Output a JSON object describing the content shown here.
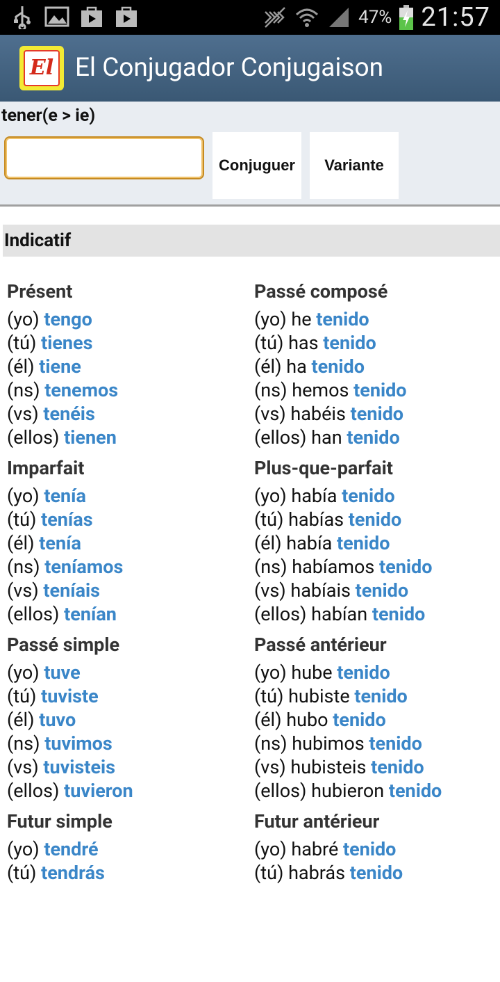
{
  "status": {
    "battery": "47%",
    "time": "21:57"
  },
  "app": {
    "title": "El Conjugador Conjugaison",
    "logo_text": "El"
  },
  "form": {
    "verb": "tener(e > ie)",
    "input_value": "",
    "conjugate_label": "Conjuguer",
    "variant_label": "Variante"
  },
  "section": "Indicatif",
  "tenses_left": [
    {
      "name": "Présent",
      "rows": [
        {
          "p": "(yo)",
          "a": "",
          "v": "tengo"
        },
        {
          "p": "(tú)",
          "a": "",
          "v": "tienes"
        },
        {
          "p": "(él)",
          "a": "",
          "v": "tiene"
        },
        {
          "p": "(ns)",
          "a": "",
          "v": "tenemos"
        },
        {
          "p": "(vs)",
          "a": "",
          "v": "tenéis"
        },
        {
          "p": "(ellos)",
          "a": "",
          "v": "tienen"
        }
      ]
    },
    {
      "name": "Imparfait",
      "rows": [
        {
          "p": "(yo)",
          "a": "",
          "v": "tenía"
        },
        {
          "p": "(tú)",
          "a": "",
          "v": "tenías"
        },
        {
          "p": "(él)",
          "a": "",
          "v": "tenía"
        },
        {
          "p": "(ns)",
          "a": "",
          "v": "teníamos"
        },
        {
          "p": "(vs)",
          "a": "",
          "v": "teníais"
        },
        {
          "p": "(ellos)",
          "a": "",
          "v": "tenían"
        }
      ]
    },
    {
      "name": "Passé simple",
      "rows": [
        {
          "p": "(yo)",
          "a": "",
          "v": "tuve"
        },
        {
          "p": "(tú)",
          "a": "",
          "v": "tuviste"
        },
        {
          "p": "(él)",
          "a": "",
          "v": "tuvo"
        },
        {
          "p": "(ns)",
          "a": "",
          "v": "tuvimos"
        },
        {
          "p": "(vs)",
          "a": "",
          "v": "tuvisteis"
        },
        {
          "p": "(ellos)",
          "a": "",
          "v": "tuvieron"
        }
      ]
    },
    {
      "name": "Futur simple",
      "rows": [
        {
          "p": "(yo)",
          "a": "",
          "v": "tendré"
        },
        {
          "p": "(tú)",
          "a": "",
          "v": "tendrás"
        }
      ]
    }
  ],
  "tenses_right": [
    {
      "name": "Passé composé",
      "rows": [
        {
          "p": "(yo)",
          "a": "he",
          "v": "tenido"
        },
        {
          "p": "(tú)",
          "a": "has",
          "v": "tenido"
        },
        {
          "p": "(él)",
          "a": "ha",
          "v": "tenido"
        },
        {
          "p": "(ns)",
          "a": "hemos",
          "v": "tenido"
        },
        {
          "p": "(vs)",
          "a": "habéis",
          "v": "tenido"
        },
        {
          "p": "(ellos)",
          "a": "han",
          "v": "tenido"
        }
      ]
    },
    {
      "name": "Plus-que-parfait",
      "rows": [
        {
          "p": "(yo)",
          "a": "había",
          "v": "tenido"
        },
        {
          "p": "(tú)",
          "a": "habías",
          "v": "tenido"
        },
        {
          "p": "(él)",
          "a": "había",
          "v": "tenido"
        },
        {
          "p": "(ns)",
          "a": "habíamos",
          "v": "tenido"
        },
        {
          "p": "(vs)",
          "a": "habíais",
          "v": "tenido"
        },
        {
          "p": "(ellos)",
          "a": "habían",
          "v": "tenido"
        }
      ]
    },
    {
      "name": "Passé antérieur",
      "rows": [
        {
          "p": "(yo)",
          "a": "hube",
          "v": "tenido"
        },
        {
          "p": "(tú)",
          "a": "hubiste",
          "v": "tenido"
        },
        {
          "p": "(él)",
          "a": "hubo",
          "v": "tenido"
        },
        {
          "p": "(ns)",
          "a": "hubimos",
          "v": "tenido"
        },
        {
          "p": "(vs)",
          "a": "hubisteis",
          "v": "tenido"
        },
        {
          "p": "(ellos)",
          "a": "hubieron",
          "v": "tenido"
        }
      ]
    },
    {
      "name": "Futur antérieur",
      "rows": [
        {
          "p": "(yo)",
          "a": "habré",
          "v": "tenido"
        },
        {
          "p": "(tú)",
          "a": "habrás",
          "v": "tenido"
        }
      ]
    }
  ],
  "colors": {
    "verb": "#3a86c8",
    "actionbar": "#4a6a8a"
  }
}
